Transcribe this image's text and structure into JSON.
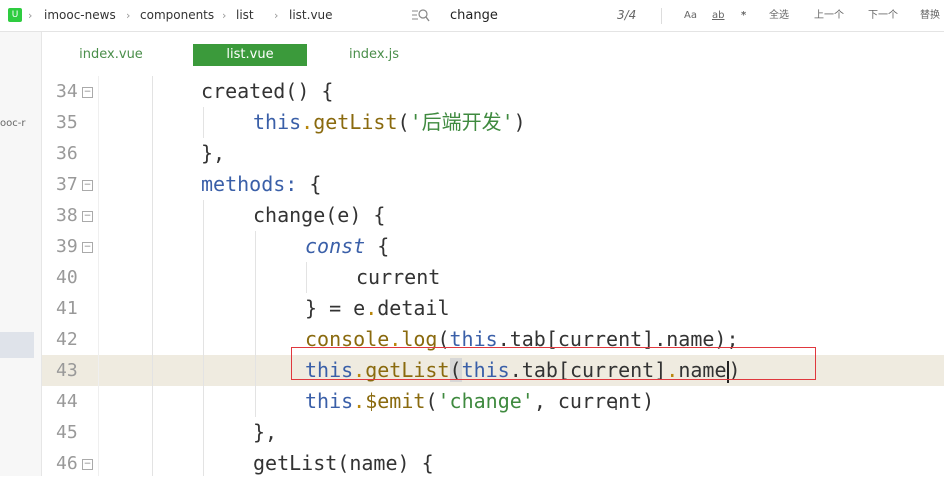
{
  "breadcrumb": {
    "app_icon": "U",
    "items": [
      "imooc-news",
      "components",
      "list",
      "list.vue"
    ]
  },
  "find": {
    "query": "change",
    "count": "3/4",
    "options": [
      "Aa",
      "ab",
      "*",
      "全选",
      "上一个",
      "下一个",
      "替换"
    ]
  },
  "side": {
    "project_label": "ooc-r"
  },
  "tabs": [
    {
      "label": "index.vue",
      "active": false
    },
    {
      "label": "list.vue",
      "active": true
    },
    {
      "label": "index.js",
      "active": false
    }
  ],
  "editor": {
    "highlight_line": "43",
    "lines": [
      {
        "num": "34",
        "fold": true
      },
      {
        "num": "35",
        "fold": false
      },
      {
        "num": "36",
        "fold": false
      },
      {
        "num": "37",
        "fold": true
      },
      {
        "num": "38",
        "fold": true
      },
      {
        "num": "39",
        "fold": true
      },
      {
        "num": "40",
        "fold": false
      },
      {
        "num": "41",
        "fold": false
      },
      {
        "num": "42",
        "fold": false
      },
      {
        "num": "43",
        "fold": false
      },
      {
        "num": "44",
        "fold": false
      },
      {
        "num": "45",
        "fold": false
      },
      {
        "num": "46",
        "fold": true
      }
    ],
    "tokens": {
      "l34": {
        "a": "created() {"
      },
      "l35": {
        "a": "this",
        "b": ".",
        "c": "getList",
        "d": "(",
        "e": "'后端开发'",
        "f": ")"
      },
      "l36": {
        "a": "},"
      },
      "l37": {
        "a": "methods:",
        "b": " {"
      },
      "l38": {
        "a": "change(e) {"
      },
      "l39": {
        "a": "const",
        "b": " {"
      },
      "l40": {
        "a": "current"
      },
      "l41": {
        "a": "} = e",
        "b": ".",
        "c": "detail"
      },
      "l42": {
        "a": "console",
        "b": ".",
        "c": "log",
        "d": "(",
        "e": "this",
        "f": ".tab[current].name);"
      },
      "l43": {
        "a": "this",
        "b": ".",
        "c": "getList",
        "d": "(",
        "e": "this",
        "f": ".tab[current]",
        "g": ".",
        "h": "name",
        "i": ")"
      },
      "l44": {
        "a": "this",
        "b": ".",
        "c": "$emit",
        "d": "(",
        "e": "'change'",
        "f": ", current)"
      },
      "l45": {
        "a": "},"
      },
      "l46": {
        "a": "getList(name) {"
      }
    }
  },
  "colors": {
    "accent_tab": "#3b9a3b",
    "search_box": "#e0383e",
    "keyword": "#3a5fa8",
    "method": "#8a6a0e",
    "string": "#3f8a3f"
  }
}
